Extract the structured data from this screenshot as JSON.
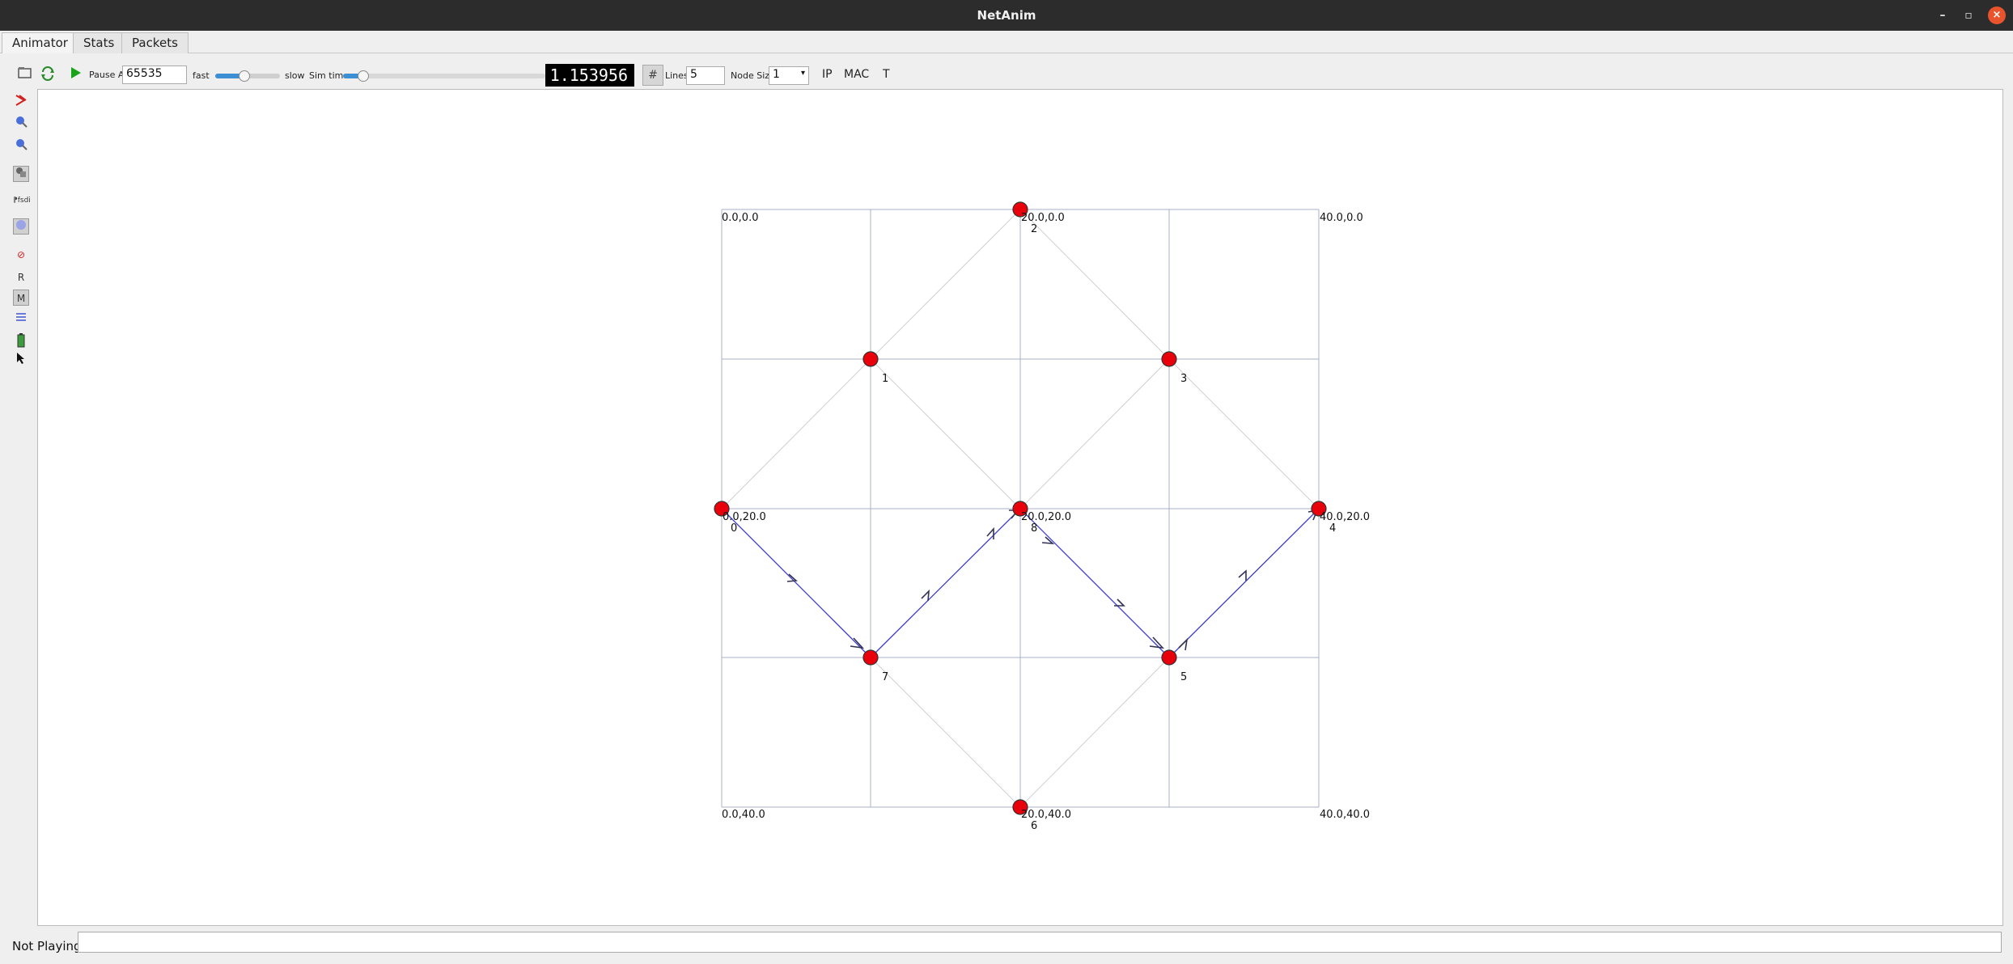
{
  "window": {
    "title": "NetAnim"
  },
  "tabs": [
    {
      "label": "Animator",
      "active": true
    },
    {
      "label": "Stats",
      "active": false
    },
    {
      "label": "Packets",
      "active": false
    }
  ],
  "toolbar": {
    "pause_at_label": "Pause At",
    "pause_at_value": "65535",
    "fast_label": "fast",
    "slow_label": "slow",
    "sim_time_label": "Sim time",
    "sim_time_display": "1.153956",
    "lines_label": "Lines",
    "lines_value": "5",
    "node_size_label": "Node Size",
    "node_size_value": "1",
    "ip_label": "IP",
    "mac_label": "MAC",
    "t_label": "T",
    "speed_level": 0.45,
    "sim_time_level": 0.1
  },
  "sidebar": {
    "r_label": "R",
    "m_label": "M"
  },
  "canvas": {
    "corner_labels": {
      "top_left": "0.0,0.0",
      "top_right": "40.0,0.0",
      "bottom_left": "0.0,40.0",
      "bottom_right": "40.0,40.0"
    },
    "nodes": [
      {
        "id": "0",
        "coord": "0.0,20.0"
      },
      {
        "id": "1",
        "coord": ""
      },
      {
        "id": "2",
        "coord": "20.0,0.0"
      },
      {
        "id": "3",
        "coord": ""
      },
      {
        "id": "4",
        "coord": "40.0,20.0"
      },
      {
        "id": "5",
        "coord": ""
      },
      {
        "id": "6",
        "coord": "20.0,40.0"
      },
      {
        "id": "7",
        "coord": ""
      },
      {
        "id": "8",
        "coord": "20.0,20.0"
      }
    ],
    "node_color": "#e8000b",
    "link_color": "#c8c8c8",
    "packet_color": "#3a3ad0"
  },
  "status": {
    "text": "Not Playing"
  }
}
